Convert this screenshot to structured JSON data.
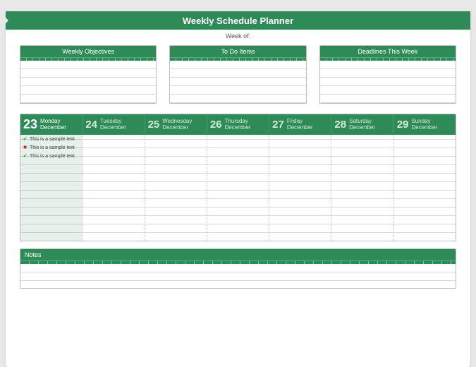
{
  "header": {
    "title": "Weekly Schedule Planner",
    "subtitle": "Week of:"
  },
  "blocks": [
    {
      "title": "Weekly Objectives"
    },
    {
      "title": "To Do Items"
    },
    {
      "title": "Deadlines This Week"
    }
  ],
  "days": [
    {
      "num": "23",
      "dow": "Monday",
      "month": "December",
      "current": true,
      "items": [
        {
          "status": "ok",
          "text": "This is a sample text"
        },
        {
          "status": "no",
          "text": "This is a sample text"
        },
        {
          "status": "ok",
          "text": "This is a sample text"
        }
      ]
    },
    {
      "num": "24",
      "dow": "Tuesday",
      "month": "December",
      "items": []
    },
    {
      "num": "25",
      "dow": "Wednesday",
      "month": "December",
      "items": []
    },
    {
      "num": "26",
      "dow": "Thursday",
      "month": "December",
      "items": []
    },
    {
      "num": "27",
      "dow": "Friday",
      "month": "December",
      "items": []
    },
    {
      "num": "28",
      "dow": "Saturday",
      "month": "December",
      "items": []
    },
    {
      "num": "29",
      "dow": "Sunday",
      "month": "December",
      "items": []
    }
  ],
  "notes": {
    "title": "Notes"
  }
}
